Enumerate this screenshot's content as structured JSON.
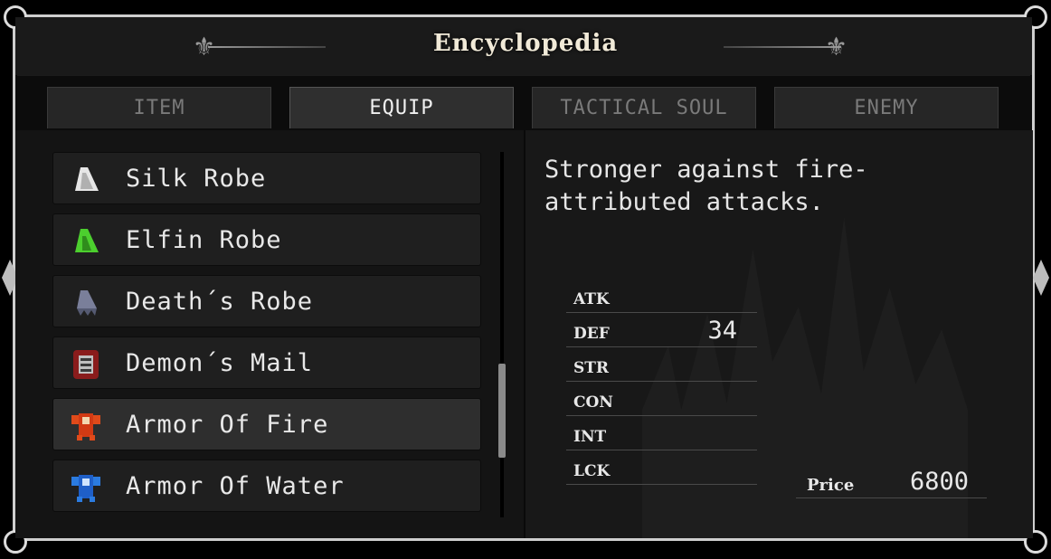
{
  "title": "Encyclopedia",
  "tabs": [
    {
      "label": "ITEM",
      "active": false
    },
    {
      "label": "EQUIP",
      "active": true
    },
    {
      "label": "TACTICAL SOUL",
      "active": false
    },
    {
      "label": "ENEMY",
      "active": false
    }
  ],
  "items": [
    {
      "label": "Silk Robe",
      "icon": "silk-robe-icon",
      "selected": false
    },
    {
      "label": "Elfin Robe",
      "icon": "elfin-robe-icon",
      "selected": false
    },
    {
      "label": "Death´s Robe",
      "icon": "deaths-robe-icon",
      "selected": false
    },
    {
      "label": "Demon´s Mail",
      "icon": "demons-mail-icon",
      "selected": false
    },
    {
      "label": "Armor Of Fire",
      "icon": "armor-of-fire-icon",
      "selected": true
    },
    {
      "label": "Armor Of Water",
      "icon": "armor-of-water-icon",
      "selected": false
    }
  ],
  "description": "Stronger against fire-attributed attacks.",
  "stats": [
    {
      "name": "ATK",
      "value": ""
    },
    {
      "name": "DEF",
      "value": "34"
    },
    {
      "name": "STR",
      "value": ""
    },
    {
      "name": "CON",
      "value": ""
    },
    {
      "name": "INT",
      "value": ""
    },
    {
      "name": "LCK",
      "value": ""
    }
  ],
  "price": {
    "label": "Price",
    "value": "6800"
  },
  "colors": {
    "panel": "#1b1b1b",
    "border": "#cfcfcf",
    "text": "#e8e8e8",
    "inactive_tab_text": "#7a7a7a"
  }
}
